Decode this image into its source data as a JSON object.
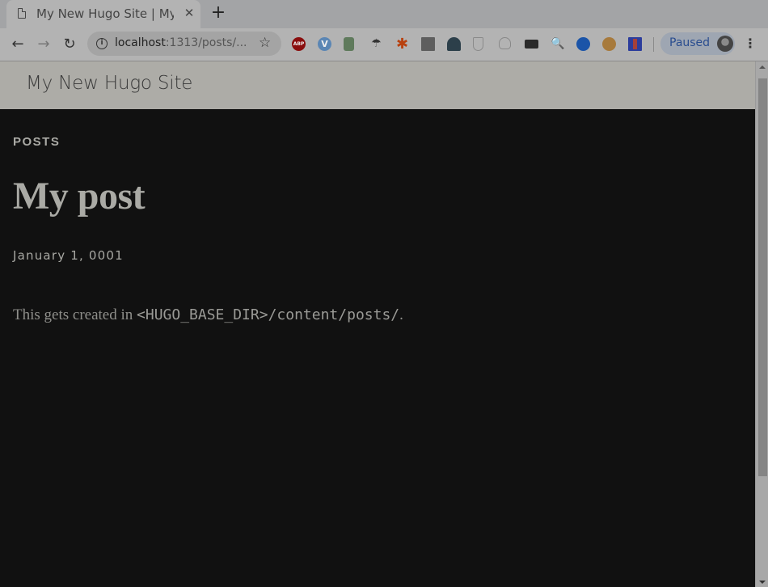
{
  "browser": {
    "tab": {
      "title": "My New Hugo Site | My post",
      "close_glyph": "✕",
      "icon": "page-icon"
    },
    "new_tab_glyph": "+",
    "nav": {
      "back_glyph": "←",
      "forward_glyph": "→",
      "reload_glyph": "↻"
    },
    "address": {
      "host": "localhost",
      "rest": ":1313/posts/...",
      "info_glyph": "i",
      "star_glyph": "☆"
    },
    "extensions": [
      {
        "name": "adblock-plus-icon",
        "label": "ABP"
      },
      {
        "name": "v-extension-icon",
        "label": "V"
      },
      {
        "name": "screen-extension-icon",
        "label": ""
      },
      {
        "name": "umbrella-extension-icon",
        "label": "☂"
      },
      {
        "name": "zapier-extension-icon",
        "label": "✱"
      },
      {
        "name": "gray-extension-icon",
        "label": ""
      },
      {
        "name": "ninja-extension-icon",
        "label": ""
      },
      {
        "name": "shield-extension-icon",
        "label": ""
      },
      {
        "name": "ghost-extension-icon",
        "label": ""
      },
      {
        "name": "keyboard-extension-icon",
        "label": ""
      },
      {
        "name": "search-extension-icon",
        "label": "🔍"
      },
      {
        "name": "blue-circle-extension-icon",
        "label": ""
      },
      {
        "name": "cookie-extension-icon",
        "label": ""
      },
      {
        "name": "lighthouse-extension-icon",
        "label": ""
      }
    ],
    "profile": {
      "label": "Paused"
    },
    "menu_glyph": "⋮",
    "scroll": {
      "thumb_start_fraction": 0.015,
      "thumb_end_fraction": 0.8
    }
  },
  "site": {
    "title": "My New Hugo Site"
  },
  "post": {
    "section": "POSTS",
    "title": "My post",
    "date": "January 1, 0001",
    "body_prefix": "This gets created in ",
    "body_code": "<HUGO_BASE_DIR>/content/posts/",
    "body_suffix": "."
  },
  "colors": {
    "page_background": "#111111",
    "header_background": "#adaca7",
    "profile_text": "#2a4d8f"
  }
}
